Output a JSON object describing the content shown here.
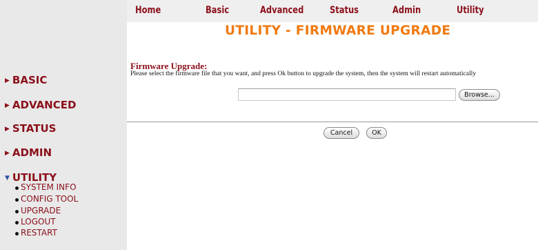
{
  "top_nav": {
    "home": "Home",
    "basic": "Basic",
    "advanced": "Advanced",
    "status": "Status",
    "admin": "Admin",
    "utility": "Utility"
  },
  "page_title": "UTILITY - FIRMWARE UPGRADE",
  "sidebar": {
    "basic": "BASIC",
    "advanced": "ADVANCED",
    "status": "STATUS",
    "admin": "ADMIN",
    "utility": "UTILITY",
    "utility_sub": [
      "SYSTEM INFO",
      "CONFIG TOOL",
      "UPGRADE",
      "LOGOUT",
      "RESTART"
    ]
  },
  "firmware": {
    "title": "Firmware Upgrade:",
    "description": "Please select the firmware file that you want, and press Ok button to upgrade the system, then the system will restart automatically",
    "file_value": "",
    "browse_label": "Browse...",
    "cancel_label": "Cancel",
    "ok_label": "OK"
  },
  "colors": {
    "brand_red": "#8b0f1a",
    "title_orange": "#f07a12",
    "sidebar_bg": "#e9e9e9"
  },
  "icons": {
    "collapsed_arrow": "triangle-right-icon",
    "expanded_arrow": "triangle-down-icon",
    "bullet": "bullet-icon"
  }
}
